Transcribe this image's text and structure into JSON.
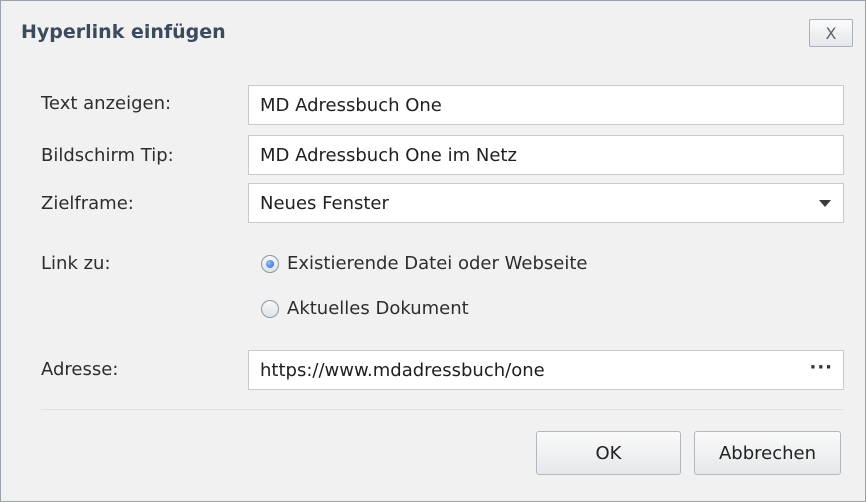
{
  "dialog": {
    "title": "Hyperlink einfügen",
    "close_label": "X"
  },
  "fields": {
    "text_label": "Text anzeigen:",
    "text_value": "MD Adressbuch One",
    "tip_label": "Bildschirm Tip:",
    "tip_value": "MD Adressbuch One im Netz",
    "target_label": "Zielframe:",
    "target_value": "Neues Fenster",
    "address_label": "Adresse:",
    "address_value": "https://www.mdadressbuch/one",
    "address_browse": "···"
  },
  "link": {
    "label": "Link zu:",
    "options": [
      {
        "label": "Existierende Datei oder Webseite",
        "selected": true
      },
      {
        "label": "Aktuelles Dokument",
        "selected": false
      }
    ]
  },
  "buttons": {
    "ok": "OK",
    "cancel": "Abbrechen"
  },
  "icons": {
    "close": "close-icon",
    "dropdown": "chevron-down-icon",
    "browse": "ellipsis-icon"
  }
}
